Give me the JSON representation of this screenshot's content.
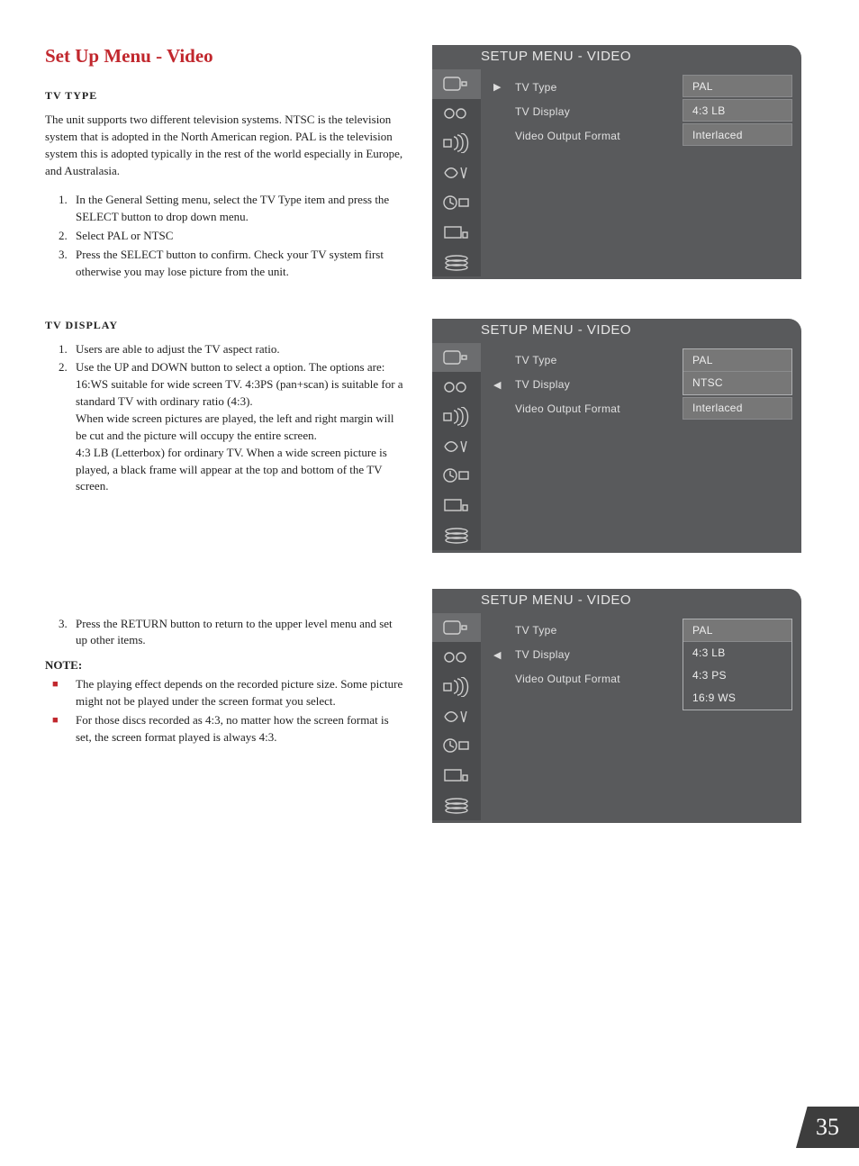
{
  "page_number": "35",
  "section_title": "Set Up Menu - Video",
  "tv_type": {
    "heading": "TV TYPE",
    "intro": "The unit supports two different television systems. NTSC is the television system that is adopted in the North American region. PAL is the television system this is adopted typically in the rest of the world especially in Europe, and Australasia.",
    "steps": [
      "In the General Setting menu, select the TV Type item and press the SELECT button to drop down menu.",
      "Select PAL or NTSC",
      "Press the SELECT button to confirm. Check your TV system first otherwise you may lose picture from the unit."
    ]
  },
  "tv_display": {
    "heading": "TV DISPLAY",
    "steps": [
      "Users are able to adjust the TV aspect ratio.",
      "Use the UP and DOWN button to select a option. The options are: 16:WS suitable for wide screen TV. 4:3PS (pan+scan) is suitable for a standard TV with ordinary ratio (4:3).\nWhen wide screen pictures are played, the left and right margin will be cut and the picture will occupy the entire screen.\n4:3 LB (Letterbox) for ordinary TV. When a wide screen picture is played, a black frame will appear at the top and bottom of the TV screen.",
      "Press the RETURN button to return to the upper level menu and set up other items."
    ]
  },
  "note": {
    "label": "NOTE:",
    "items": [
      "The playing effect depends on the recorded picture size. Some picture might not be played under the screen format you select.",
      "For those discs recorded as 4:3, no matter how the screen format is set, the screen format played is always 4:3."
    ]
  },
  "osd_common": {
    "title": "SETUP MENU - VIDEO",
    "labels": {
      "tv_type": "TV Type",
      "tv_display": "TV Display",
      "video_output": "Video Output Format"
    }
  },
  "osd1": {
    "cursor_row": 0,
    "cursor_glyph": "▶",
    "options": [
      {
        "text": "PAL",
        "style": "box"
      },
      {
        "text": "4:3 LB",
        "style": "box"
      },
      {
        "text": "Interlaced",
        "style": "box"
      }
    ]
  },
  "osd2": {
    "cursor_row": 1,
    "cursor_glyph": "◀",
    "group": true,
    "options": [
      {
        "text": "PAL",
        "style": "box"
      },
      {
        "text": "NTSC",
        "style": "box"
      },
      {
        "text": "Interlaced",
        "style": "box-after-gap"
      }
    ]
  },
  "osd3": {
    "cursor_row": 1,
    "cursor_glyph": "◀",
    "group": true,
    "options": [
      {
        "text": "PAL",
        "style": "box"
      },
      {
        "text": "4:3 LB",
        "style": "flat"
      },
      {
        "text": "4:3 PS",
        "style": "flat"
      },
      {
        "text": "16:9 WS",
        "style": "flat"
      }
    ]
  }
}
